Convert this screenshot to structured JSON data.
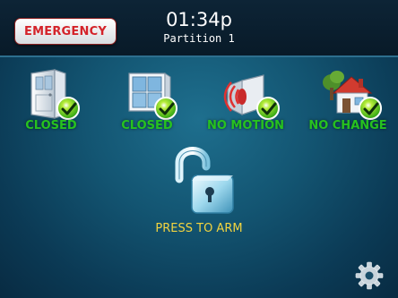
{
  "header": {
    "emergency_label": "EMERGENCY",
    "time": "01:34p",
    "partition": "Partition 1"
  },
  "status_tiles": [
    {
      "label": "CLOSED",
      "icon": "door-icon"
    },
    {
      "label": "CLOSED",
      "icon": "window-icon"
    },
    {
      "label": "NO MOTION",
      "icon": "motion-sensor-icon"
    },
    {
      "label": "NO CHANGE",
      "icon": "house-icon"
    }
  ],
  "arm": {
    "label": "PRESS TO ARM",
    "icon": "unlocked-padlock-icon"
  },
  "settings": {
    "icon": "gear-icon"
  },
  "colors": {
    "status_ok": "#27c21f",
    "arm_text": "#f3d43f",
    "emergency_text": "#d4232a",
    "background": "#135572"
  }
}
